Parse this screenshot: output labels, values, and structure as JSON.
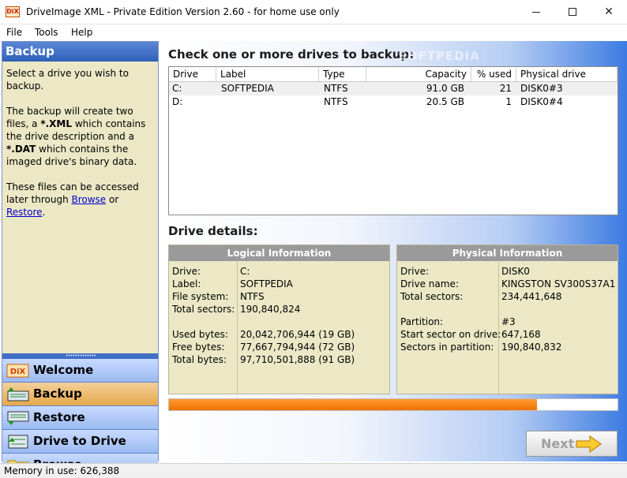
{
  "window": {
    "title": "DriveImage XML - Private Edition Version 2.60 - for home use only",
    "icon": "dix-app-icon"
  },
  "menu": [
    "File",
    "Tools",
    "Help"
  ],
  "left_panel": {
    "header": "Backup",
    "desc1": "Select a drive you wish to backup.",
    "desc2_a": "The backup will create two files, a ",
    "desc2_b": "*.XML",
    "desc2_c": " which contains the drive description and a ",
    "desc2_d": "*.DAT",
    "desc2_e": " which contains the imaged drive's binary data.",
    "desc3_a": "These files can be accessed later through ",
    "desc3_link1": "Browse",
    "desc3_b": " or ",
    "desc3_link2": "Restore",
    "desc3_c": ".",
    "nav": [
      {
        "label": "Welcome",
        "icon": "dix-icon"
      },
      {
        "label": "Backup",
        "icon": "backup-icon"
      },
      {
        "label": "Restore",
        "icon": "restore-icon"
      },
      {
        "label": "Drive to Drive",
        "icon": "drive-to-drive-icon"
      },
      {
        "label": "Browse",
        "icon": "folder-icon"
      }
    ]
  },
  "main": {
    "title": "Check one or more drives to backup:",
    "watermark": "SOFTPEDIA",
    "columns": [
      "Drive",
      "Label",
      "Type",
      "Capacity",
      "% used",
      "Physical drive"
    ],
    "drives": [
      {
        "drive": "C:",
        "label": "SOFTPEDIA",
        "type": "NTFS",
        "capacity": "91.0 GB",
        "used": "21",
        "physical": "DISK0#3"
      },
      {
        "drive": "D:",
        "label": "",
        "type": "NTFS",
        "capacity": "20.5 GB",
        "used": "1",
        "physical": "DISK0#4"
      }
    ],
    "details_title": "Drive details:",
    "logical": {
      "title": "Logical Information",
      "labels": [
        "Drive:",
        "Label:",
        "File system:",
        "Total sectors:",
        "Used bytes:",
        "Free bytes:",
        "Total bytes:"
      ],
      "values": [
        "C:",
        "SOFTPEDIA",
        "NTFS",
        "190,840,824",
        "20,042,706,944 (19 GB)",
        "77,667,794,944 (72 GB)",
        "97,710,501,888 (91 GB)"
      ]
    },
    "physical": {
      "title": "Physical Information",
      "labels": [
        "Drive:",
        "Drive name:",
        "Total sectors:",
        "Partition:",
        "Start sector on drive:",
        "Sectors in partition:"
      ],
      "values": [
        "DISK0",
        "KINGSTON SV300S37A1",
        "234,441,648",
        "#3",
        "647,168",
        "190,840,832"
      ]
    },
    "progress": 0.82,
    "next_label": "Next"
  },
  "status": "Memory in use: 626,388",
  "colors": {
    "accent": "#2f5fb8",
    "panel_bg": "#ece8c6",
    "progress": "#ee7100",
    "active_nav": "#e6a84c"
  }
}
